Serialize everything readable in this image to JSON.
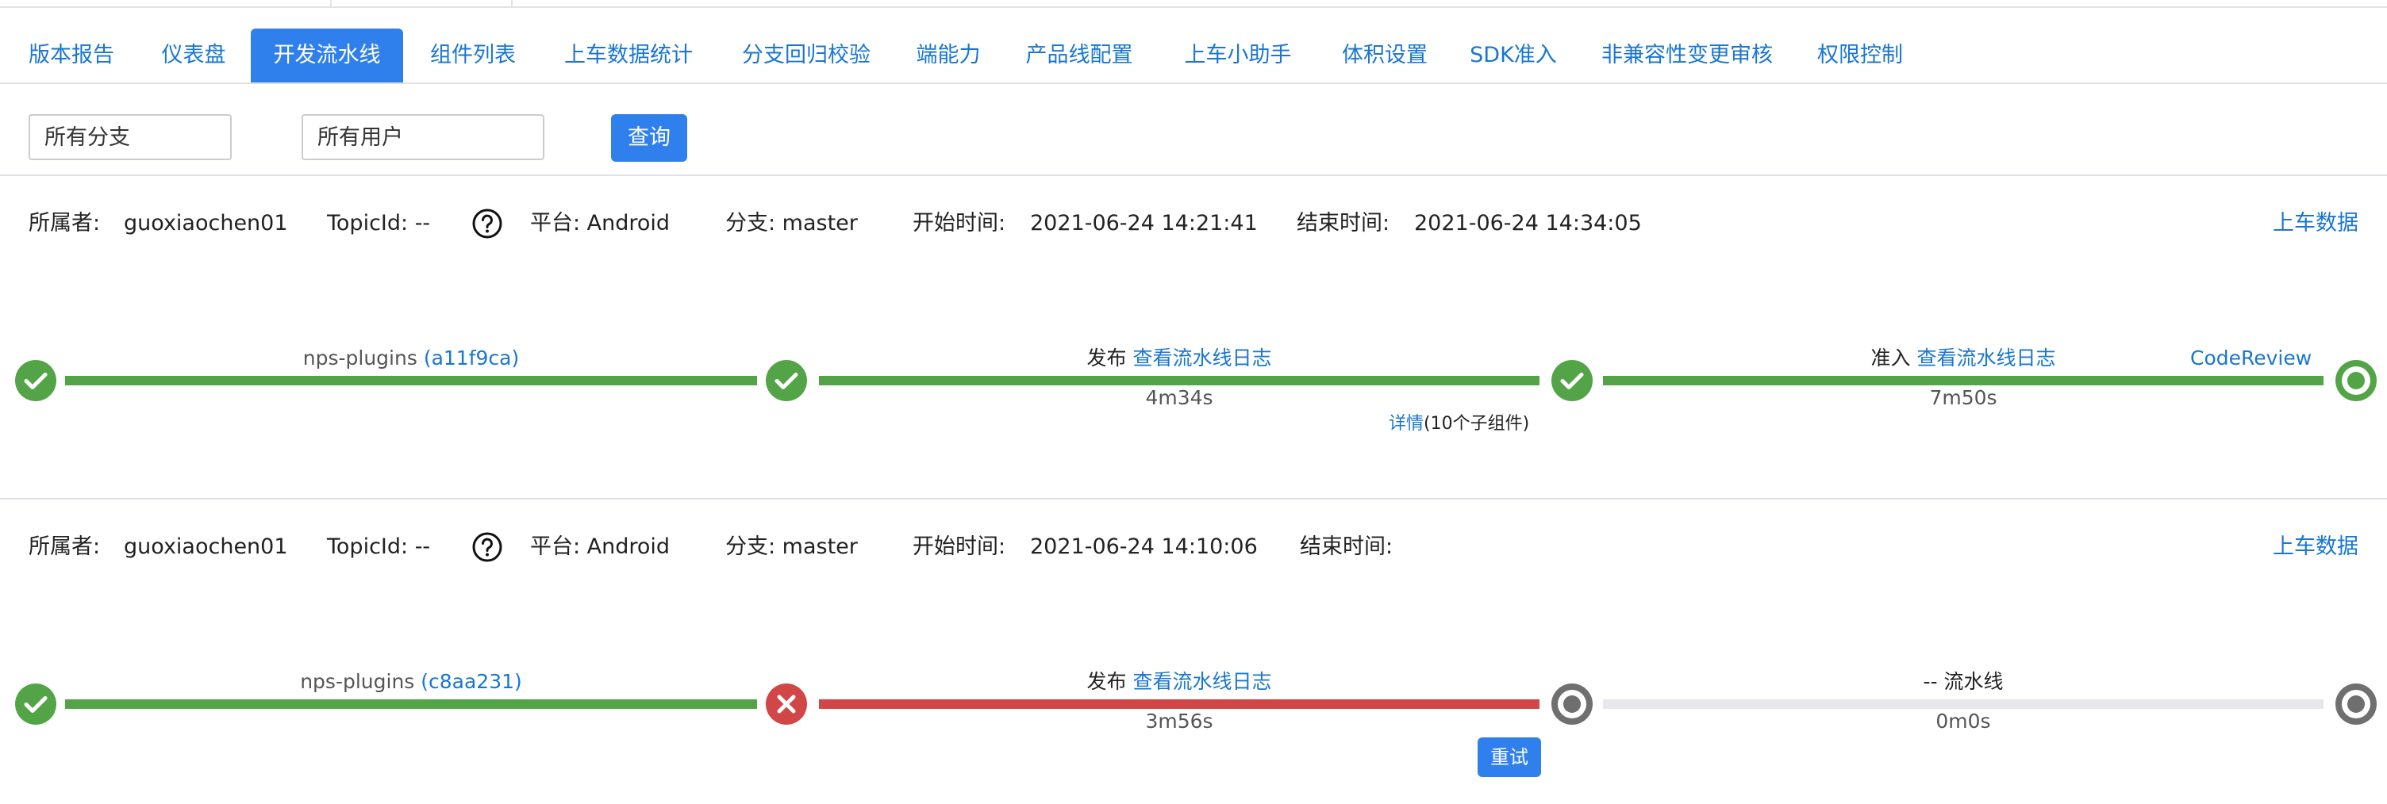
{
  "tabs": [
    "版本报告",
    "仪表盘",
    "开发流水线",
    "组件列表",
    "上车数据统计",
    "分支回归校验",
    "端能力",
    "产品线配置",
    "上车小助手",
    "体积设置",
    "SDK准入",
    "非兼容性变更审核",
    "权限控制"
  ],
  "filters": {
    "branch_placeholder": "所有分支",
    "user_placeholder": "所有用户",
    "query_label": "查询"
  },
  "records": [
    {
      "owner_label": "所属者:",
      "owner": "guoxiaochen01",
      "topic": "TopicId: --",
      "platform": "平台: Android",
      "branch": "分支: master",
      "start_label": "开始时间:",
      "start": "2021-06-24 14:21:41",
      "end_label": "结束时间:",
      "end": "2021-06-24 14:34:05",
      "data_link": "上车数据",
      "stage1": {
        "name": "nps-plugins",
        "commit": "(a11f9ca)",
        "status": "success"
      },
      "stage2": {
        "name": "发布",
        "log": "查看流水线日志",
        "duration": "4m34s",
        "status": "success",
        "detail_link": "详情",
        "detail_text": "(10个子组件)"
      },
      "stage3": {
        "name": "准入",
        "log": "查看流水线日志",
        "duration": "7m50s",
        "status": "success",
        "extra_link": "CodeReview"
      },
      "end_node": "target"
    },
    {
      "owner_label": "所属者:",
      "owner": "guoxiaochen01",
      "topic": "TopicId: --",
      "platform": "平台: Android",
      "branch": "分支: master",
      "start_label": "开始时间:",
      "start": "2021-06-24 14:10:06",
      "end_label": "结束时间:",
      "end": "",
      "data_link": "上车数据",
      "stage1": {
        "name": "nps-plugins",
        "commit": "(c8aa231)",
        "status": "success"
      },
      "stage2": {
        "name": "发布",
        "log": "查看流水线日志",
        "duration": "3m56s",
        "status": "failed",
        "retry": "重试"
      },
      "stage3": {
        "name": "-- 流水线",
        "duration": "0m0s",
        "status": "pending"
      },
      "end_node": "target"
    }
  ],
  "colors": {
    "accent": "#2f80ed",
    "link": "#1976d2",
    "success": "#52a447",
    "failed": "#d14646",
    "pending": "#6f6f6f"
  },
  "icons": [
    "check-circle-icon",
    "close-circle-icon",
    "target-circle-icon",
    "help-icon"
  ]
}
